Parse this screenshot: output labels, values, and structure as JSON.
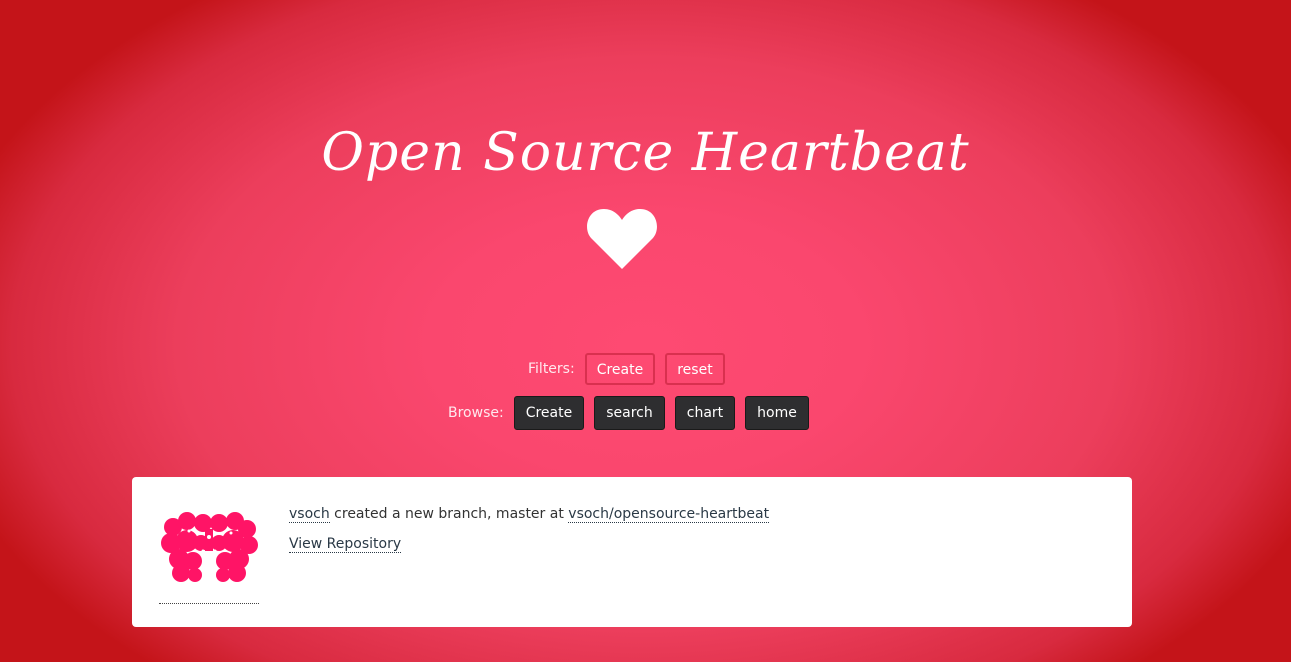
{
  "header": {
    "title": "Open Source Heartbeat"
  },
  "filters": {
    "label": "Filters:",
    "buttons": [
      "Create",
      "reset"
    ]
  },
  "browse": {
    "label": "Browse:",
    "buttons": [
      "Create",
      "search",
      "chart",
      "home"
    ]
  },
  "event": {
    "user": "vsoch",
    "action_text": "created a new branch, master at",
    "repo": "vsoch/opensource-heartbeat",
    "view_link": "View Repository",
    "avatar_icon": "user-avatar-icon"
  },
  "colors": {
    "background_center": "#fe4a72",
    "background_edge": "#c41419",
    "dark_button": "#2e2e30",
    "avatar_pink": "#ff1466"
  }
}
